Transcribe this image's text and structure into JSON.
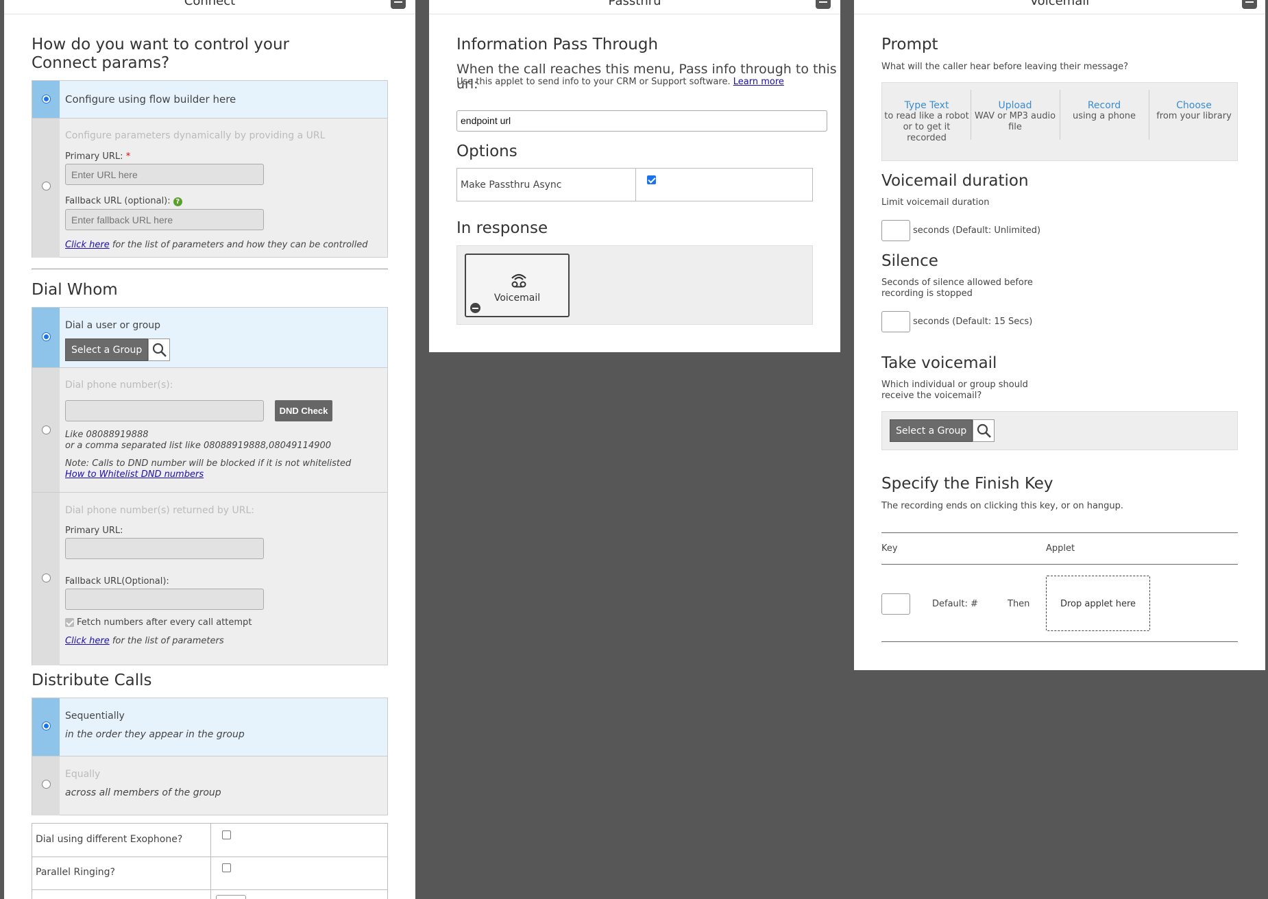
{
  "connect": {
    "title": "Connect",
    "heading": "How do you want to control your Connect params?",
    "config_flow": "Configure using flow builder here",
    "config_url": "Configure parameters dynamically by providing a URL",
    "primary_url_label": "Primary URL:",
    "required_mark": "*",
    "primary_url_placeholder": "Enter URL here",
    "fallback_url_label": "Fallback URL (optional):",
    "fallback_url_placeholder": "Enter fallback URL here",
    "click_here": "Click here",
    "params_note": "for the list of parameters and how they can be controlled",
    "dial_whom": "Dial Whom",
    "dial_user": "Dial a user or group",
    "select_group": "Select a Group",
    "dial_numbers": "Dial phone number(s):",
    "dnd_check": "DND Check",
    "like_line1": "Like 08088919888",
    "like_line2": "or a comma separated list like 08088919888,08049114900",
    "dnd_note": "Note: Calls to DND number will be blocked if it is not whitelisted",
    "whitelist_link": "How to Whitelist DND numbers",
    "dial_by_url": "Dial phone number(s) returned by URL:",
    "primary_url2": "Primary URL:",
    "fallback_url2": "Fallback URL(Optional):",
    "fetch_numbers": "Fetch numbers after every call attempt",
    "click_here2": "Click here",
    "params_note2": "for the list of parameters",
    "distribute_calls": "Distribute Calls",
    "seq": "Sequentially",
    "seq_sub": "in the order they appear in the group",
    "equal": "Equally",
    "equal_sub": "across all members of the group",
    "diff_exophone": "Dial using different Exophone?",
    "parallel": "Parallel Ringing?"
  },
  "passthru": {
    "title": "Passthru",
    "heading": "Information Pass Through",
    "desc": "When the call reaches this menu, Pass info through to this url:",
    "desc_small": "Use this applet to send info to your CRM or Support software.",
    "learn_more": "Learn more",
    "url_value": "endpoint url",
    "options": "Options",
    "async_label": "Make Passthru Async",
    "in_response": "In response",
    "voicemail_applet": "Voicemail"
  },
  "voicemail": {
    "title": "Voicemail",
    "prompt": "Prompt",
    "prompt_sub": "What will the caller hear before leaving their message?",
    "tiles": [
      {
        "title": "Type Text",
        "desc": "to read like a robot or to get it recorded"
      },
      {
        "title": "Upload",
        "desc": "WAV or MP3 audio file"
      },
      {
        "title": "Record",
        "desc": "using a phone"
      },
      {
        "title": "Choose",
        "desc": "from your library"
      }
    ],
    "duration": "Voicemail duration",
    "duration_sub": "Limit voicemail duration",
    "duration_hint": "seconds (Default: Unlimited)",
    "silence": "Silence",
    "silence_sub": "Seconds of silence allowed before recording is stopped",
    "silence_hint": "seconds (Default: 15 Secs)",
    "take": "Take voicemail",
    "take_sub": "Which individual or group should receive the voicemail?",
    "select_group": "Select a Group",
    "finish_key": "Specify the Finish Key",
    "finish_sub": "The recording ends on clicking this key, or on hangup.",
    "col_key": "Key",
    "col_applet": "Applet",
    "default_key": "Default: #",
    "then": "Then",
    "drop_applet": "Drop applet here"
  }
}
